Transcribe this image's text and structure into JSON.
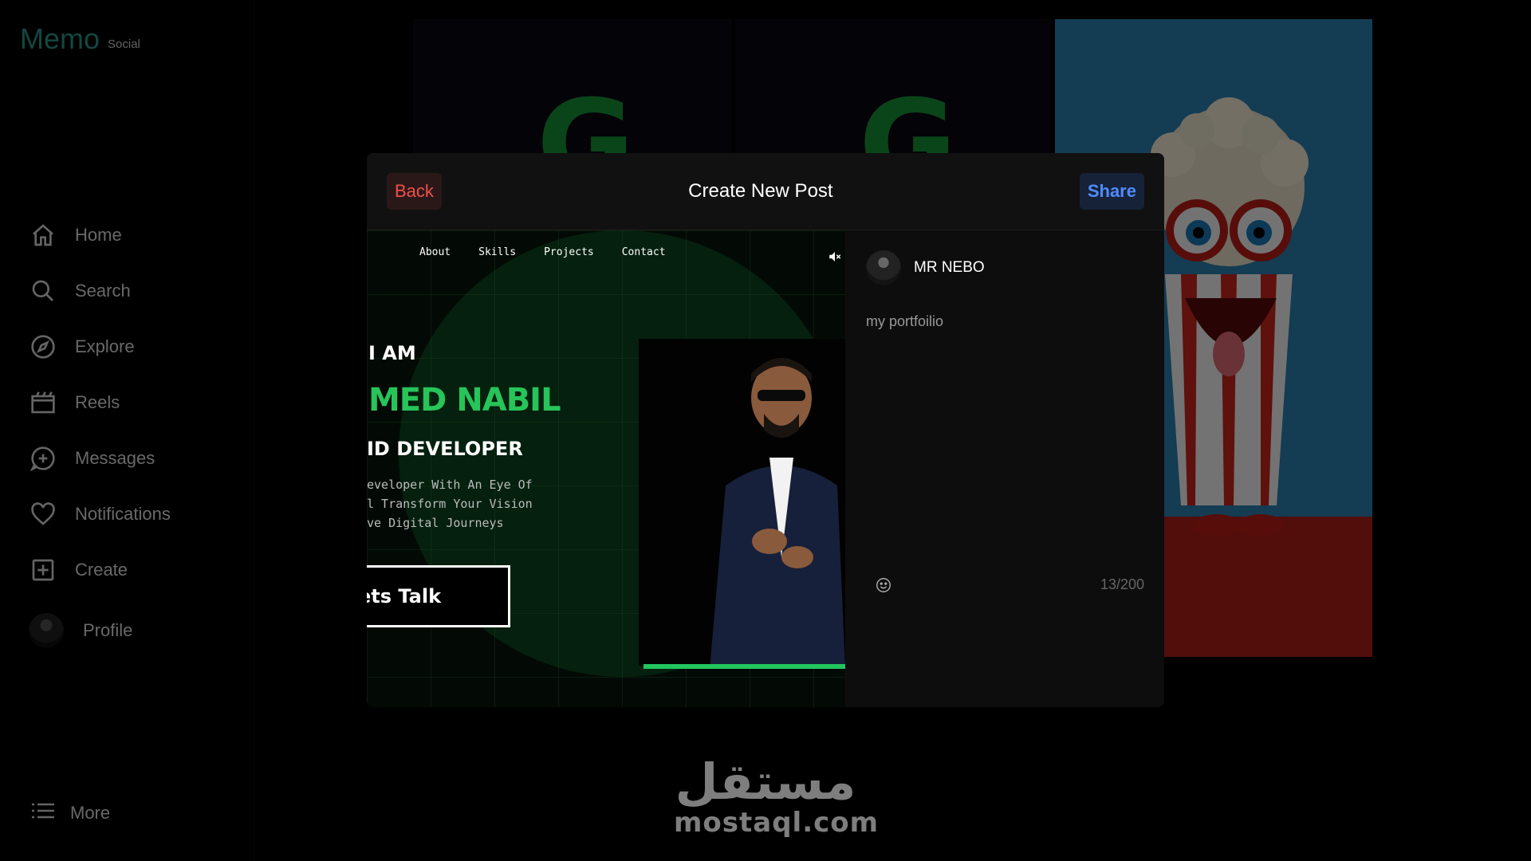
{
  "brand": {
    "name": "Memo",
    "tagline": "Social",
    "accent_color": "#2a9d8f"
  },
  "sidebar": {
    "items": [
      {
        "label": "Home",
        "icon": "home-icon"
      },
      {
        "label": "Search",
        "icon": "search-icon"
      },
      {
        "label": "Explore",
        "icon": "compass-icon"
      },
      {
        "label": "Reels",
        "icon": "clapperboard-icon"
      },
      {
        "label": "Messages",
        "icon": "message-plus-icon"
      },
      {
        "label": "Notifications",
        "icon": "heart-icon"
      },
      {
        "label": "Create",
        "icon": "plus-square-icon"
      },
      {
        "label": "Profile",
        "icon": "avatar"
      }
    ],
    "more_label": "More"
  },
  "feed": {
    "tiles": [
      "g-letter-thumbnail",
      "g-letter-thumbnail",
      "popcorn-mascot"
    ],
    "g_letter": "G"
  },
  "modal": {
    "title": "Create New Post",
    "back_label": "Back",
    "share_label": "Share",
    "back_color": "#f0504a",
    "share_color": "#4f8cff",
    "preview": {
      "nav": [
        "About",
        "Skills",
        "Projects",
        "Contact"
      ],
      "iam": "I AM",
      "name": "MED NABIL",
      "role": "ID DEVELOPER",
      "desc_lines": [
        "eveloper With An Eye Of",
        "l Transform Your Vision",
        "ve Digital Journeys"
      ],
      "cta": "ets Talk",
      "accent": "#27c45a"
    },
    "composer": {
      "username": "MR NEBO",
      "caption": "my portfoilio",
      "counter": "13/200"
    }
  },
  "watermark": {
    "arabic": "مستقل",
    "latin": "mostaql.com"
  }
}
